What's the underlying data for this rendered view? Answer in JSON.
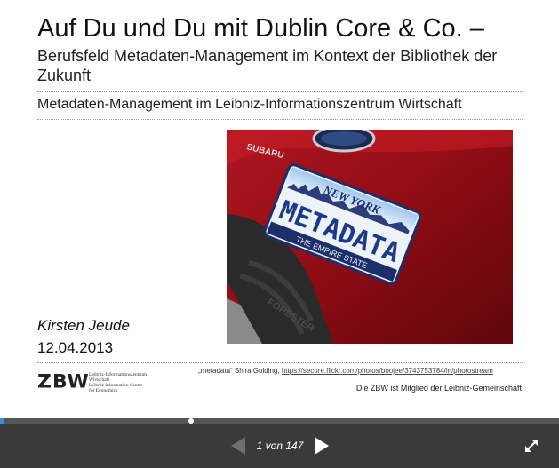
{
  "slide": {
    "title": "Auf Du und Du mit Dublin Core & Co. –",
    "subtitle": "Berufsfeld Metadaten-Management im Kontext der Bibliothek der Zukunft",
    "org_line": "Metadaten-Management im Leibniz-Informationszentrum Wirtschaft",
    "author": "Kirsten Jeude",
    "date": "12.04.2013",
    "photo": {
      "plate_state": "NEW YORK",
      "plate_text": "METADATA",
      "plate_motto": "THE EMPIRE STATE",
      "badge_top": "SUBARU",
      "bumper_text": "FORESTER"
    },
    "logo": {
      "mark": "ZBW",
      "line1": "Leibniz-Informationszentrum",
      "line2": "Wirtschaft",
      "line3": "Leibniz Information Centre",
      "line4": "for Economics"
    },
    "credit_text": "„metadata“ Shira Golding,",
    "credit_link": "https://secure.flickr.com/photos/boojee/3743753784/in/photostream",
    "member_text": "Die ZBW ist Mitglied der Leibniz-Gemeinschaft"
  },
  "player": {
    "page_indicator": "1 von 147",
    "current_page": 1,
    "total_pages": 147,
    "progress_fraction": 0.0068,
    "prev_icon": "prev-triangle-icon",
    "next_icon": "next-triangle-icon",
    "fullscreen_icon": "fullscreen-arrows-icon",
    "colors": {
      "bar": "#3a3a3a",
      "track": "#555555",
      "accent": "#3b8ed8"
    }
  }
}
